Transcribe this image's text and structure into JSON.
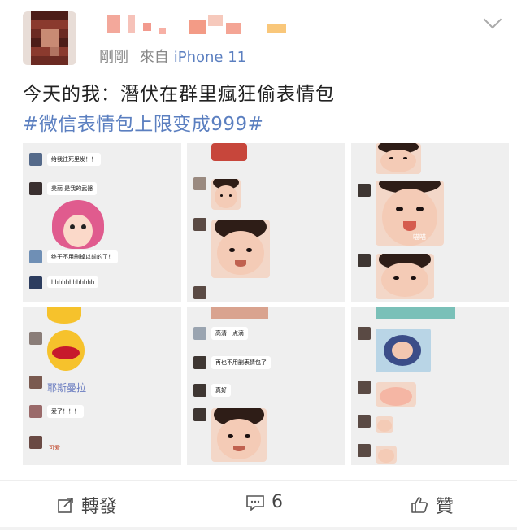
{
  "post": {
    "time": "剛剛",
    "source": "來自",
    "device": "iPhone 11",
    "text": "今天的我：潛伏在群里瘋狂偷表情包",
    "hashtag": "#微信表情包上限变成999#"
  },
  "chat": {
    "c1": {
      "m1": "给我往死里发！！",
      "m2": "美丽 是我的武器",
      "m3": "终于不用删掉以前的了！",
      "m4": "hhhhhhhhhhhh"
    },
    "c5": {
      "m1": "耶斯曼拉",
      "m2": "爱了！！！",
      "m3": "可爱"
    },
    "c6": {
      "m1": "高清一点滴",
      "m2": "再也不用删表情包了",
      "m3": "真好"
    },
    "c3": {
      "label": "喵喵"
    }
  },
  "footer": {
    "repost": "轉發",
    "comments": "6",
    "like": "贊"
  },
  "colors": {
    "link": "#5b7fc0",
    "meta": "#888888"
  }
}
